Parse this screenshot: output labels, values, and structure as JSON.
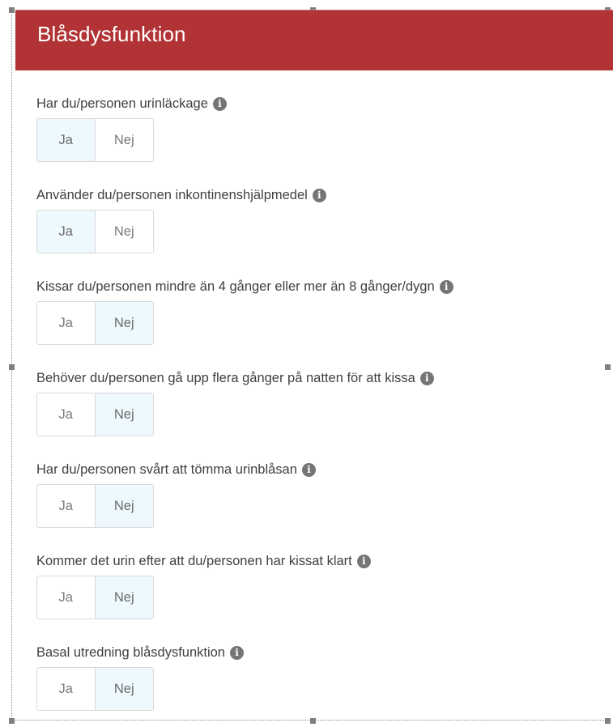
{
  "section": {
    "title": "Blåsdysfunktion"
  },
  "questions": [
    {
      "label": "Har du/personen urinläckage",
      "options": [
        "Ja",
        "Nej"
      ],
      "selected": "Ja"
    },
    {
      "label": "Använder du/personen inkontinenshjälpmedel",
      "options": [
        "Ja",
        "Nej"
      ],
      "selected": "Ja"
    },
    {
      "label": "Kissar du/personen mindre än 4 gånger eller mer än 8 gånger/dygn",
      "options": [
        "Ja",
        "Nej"
      ],
      "selected": "Nej"
    },
    {
      "label": "Behöver du/personen gå upp flera gånger på natten för att kissa",
      "options": [
        "Ja",
        "Nej"
      ],
      "selected": "Nej"
    },
    {
      "label": "Har du/personen svårt att tömma urinblåsan",
      "options": [
        "Ja",
        "Nej"
      ],
      "selected": "Nej"
    },
    {
      "label": "Kommer det urin efter att du/personen har kissat klart",
      "options": [
        "Ja",
        "Nej"
      ],
      "selected": "Nej"
    },
    {
      "label": "Basal utredning blåsdysfunktion",
      "options": [
        "Ja",
        "Nej"
      ],
      "selected": "Nej"
    }
  ],
  "icons": {
    "info": "info-icon",
    "info_glyph": "i"
  },
  "colors": {
    "header_bg": "#b23335",
    "selected_bg": "#eef9fd"
  }
}
